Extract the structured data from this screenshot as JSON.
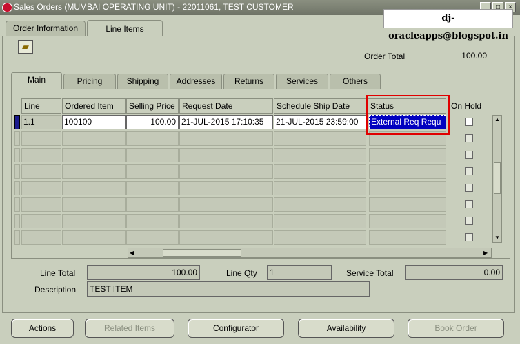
{
  "window": {
    "title": "Sales Orders (MUMBAI OPERATING UNIT) - 22011061, TEST CUSTOMER",
    "controls": [
      "_",
      "□",
      "×"
    ]
  },
  "watermark": "dj-oracleapps@blogspot.in",
  "top_tabs": [
    {
      "label": "Order Information",
      "active": false
    },
    {
      "label": "Line Items",
      "active": true
    }
  ],
  "toolbar": {
    "icon": "folder-open-icon"
  },
  "order_total": {
    "label": "Order Total",
    "value": "100.00"
  },
  "sub_tabs": [
    {
      "label": "Main",
      "active": true
    },
    {
      "label": "Pricing",
      "active": false
    },
    {
      "label": "Shipping",
      "active": false
    },
    {
      "label": "Addresses",
      "active": false
    },
    {
      "label": "Returns",
      "active": false
    },
    {
      "label": "Services",
      "active": false
    },
    {
      "label": "Others",
      "active": false
    }
  ],
  "grid": {
    "columns": [
      "Line",
      "Ordered Item",
      "Selling Price",
      "Request Date",
      "Schedule Ship Date",
      "Status",
      "On Hold"
    ],
    "rows": [
      {
        "line": "1.1",
        "ordered_item": "100100",
        "selling_price": "100.00",
        "request_date": "21-JUL-2015 17:10:35",
        "schedule_ship_date": "21-JUL-2015 23:59:00",
        "status": "External Req Requ",
        "on_hold": false
      },
      {
        "line": "",
        "ordered_item": "",
        "selling_price": "",
        "request_date": "",
        "schedule_ship_date": "",
        "status": "",
        "on_hold": false
      },
      {
        "line": "",
        "ordered_item": "",
        "selling_price": "",
        "request_date": "",
        "schedule_ship_date": "",
        "status": "",
        "on_hold": false
      },
      {
        "line": "",
        "ordered_item": "",
        "selling_price": "",
        "request_date": "",
        "schedule_ship_date": "",
        "status": "",
        "on_hold": false
      },
      {
        "line": "",
        "ordered_item": "",
        "selling_price": "",
        "request_date": "",
        "schedule_ship_date": "",
        "status": "",
        "on_hold": false
      },
      {
        "line": "",
        "ordered_item": "",
        "selling_price": "",
        "request_date": "",
        "schedule_ship_date": "",
        "status": "",
        "on_hold": false
      },
      {
        "line": "",
        "ordered_item": "",
        "selling_price": "",
        "request_date": "",
        "schedule_ship_date": "",
        "status": "",
        "on_hold": false
      },
      {
        "line": "",
        "ordered_item": "",
        "selling_price": "",
        "request_date": "",
        "schedule_ship_date": "",
        "status": "",
        "on_hold": false
      }
    ],
    "highlight_color": "#e00000",
    "selection_color": "#0000c0"
  },
  "totals": {
    "line_total_label": "Line Total",
    "line_total_value": "100.00",
    "line_qty_label": "Line Qty",
    "line_qty_value": "1",
    "service_total_label": "Service Total",
    "service_total_value": "0.00",
    "description_label": "Description",
    "description_value": "TEST ITEM"
  },
  "buttons": [
    {
      "label": "Actions",
      "mnemonic": "A",
      "rest": "ctions",
      "enabled": true
    },
    {
      "label": "Related Items",
      "mnemonic": "R",
      "rest": "elated Items",
      "enabled": false
    },
    {
      "label": "Configurator",
      "mnemonic": "",
      "rest": "Configurator",
      "enabled": true
    },
    {
      "label": "Availability",
      "mnemonic": "",
      "rest": "Availability",
      "enabled": true
    },
    {
      "label": "Book Order",
      "mnemonic": "B",
      "rest": "ook Order",
      "enabled": false
    }
  ]
}
